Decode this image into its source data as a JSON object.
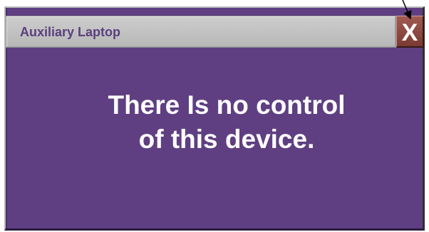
{
  "window": {
    "title": "Auxiliary Laptop",
    "close_label": "X",
    "accent_color": "#5f3f82",
    "close_button_color": "#8c4740"
  },
  "message": {
    "line1": "There Is no control",
    "line2": "of this device."
  },
  "icons": {
    "close": "close-icon",
    "annotation": "pointer-arrow-icon"
  }
}
